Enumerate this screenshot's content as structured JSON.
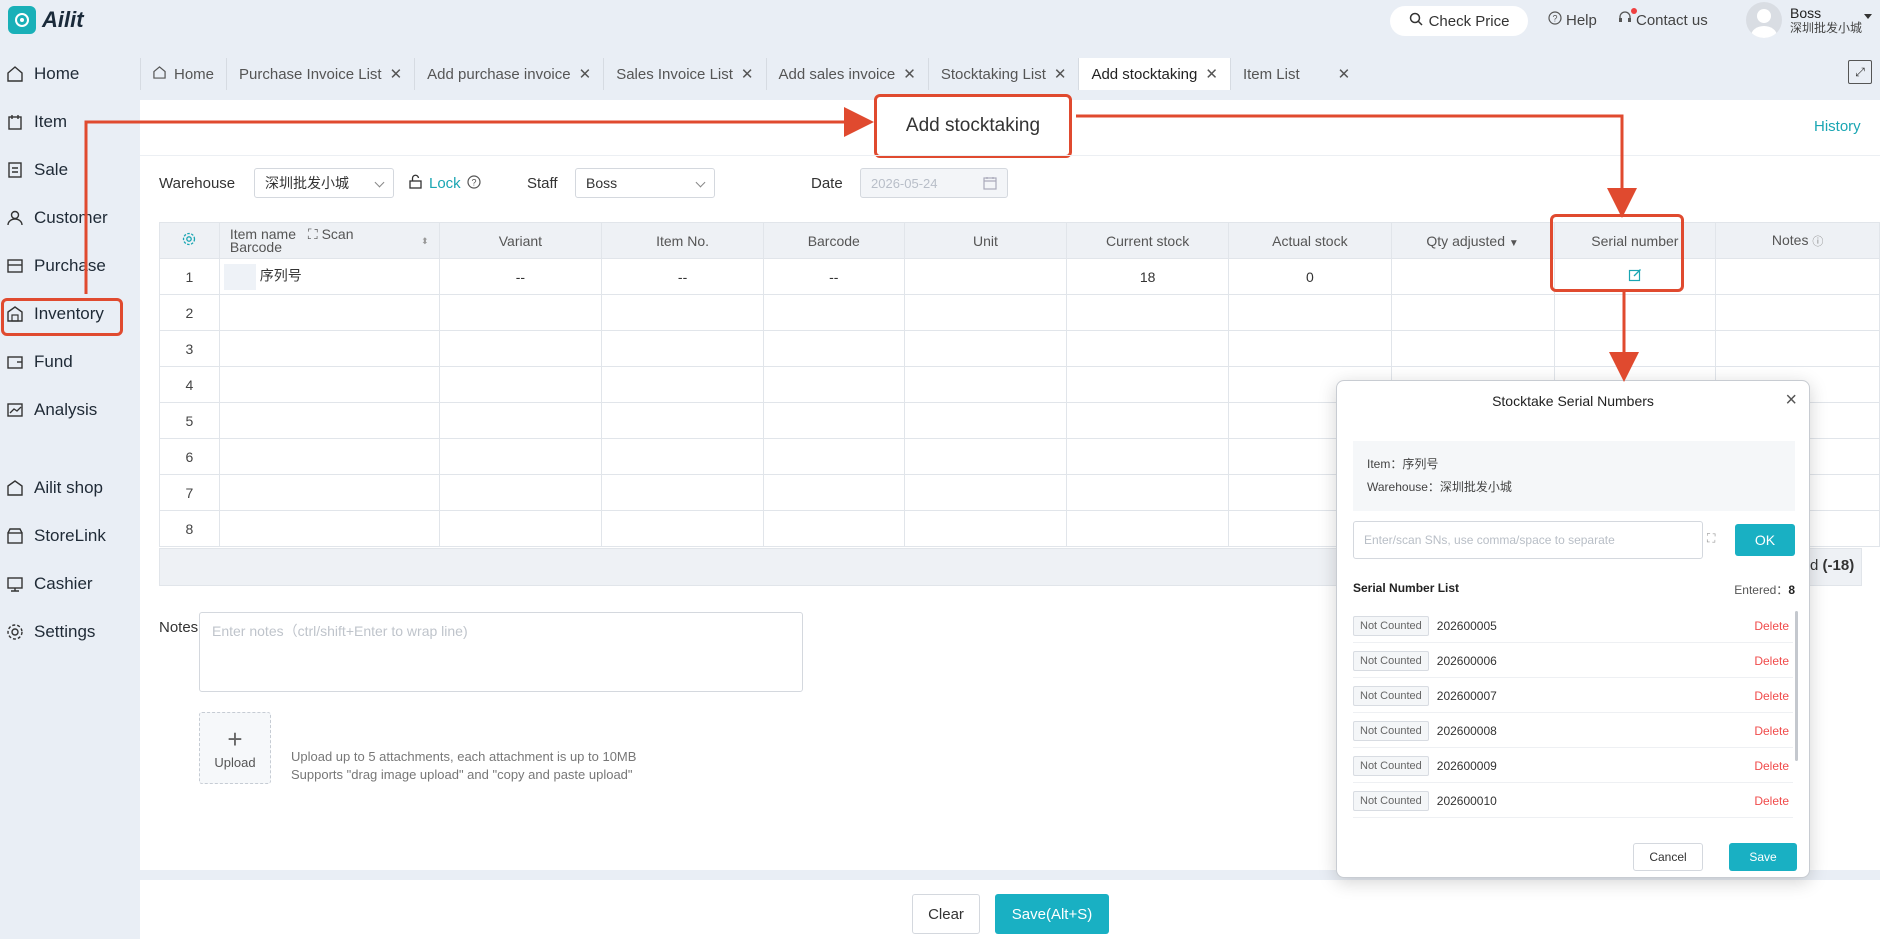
{
  "app": {
    "name": "Ailit",
    "check_price": "Check Price",
    "help": "Help",
    "contact": "Contact us",
    "user_name": "Boss",
    "user_shop": "深圳批发小城"
  },
  "sidebar": {
    "items": [
      {
        "label": "Home",
        "icon": "home-icon"
      },
      {
        "label": "Item",
        "icon": "item-icon"
      },
      {
        "label": "Sale",
        "icon": "sale-icon"
      },
      {
        "label": "Customer",
        "icon": "customer-icon"
      },
      {
        "label": "Purchase",
        "icon": "purchase-icon"
      },
      {
        "label": "Inventory",
        "icon": "inventory-icon"
      },
      {
        "label": "Fund",
        "icon": "fund-icon"
      },
      {
        "label": "Analysis",
        "icon": "analysis-icon"
      },
      {
        "label": "Ailit shop",
        "icon": "shop-icon"
      },
      {
        "label": "StoreLink",
        "icon": "storelink-icon"
      },
      {
        "label": "Cashier",
        "icon": "cashier-icon"
      },
      {
        "label": "Settings",
        "icon": "settings-icon"
      }
    ]
  },
  "tabs": [
    {
      "label": "Home",
      "closable": false
    },
    {
      "label": "Purchase Invoice List",
      "closable": true
    },
    {
      "label": "Add purchase invoice",
      "closable": true
    },
    {
      "label": "Sales Invoice List",
      "closable": true
    },
    {
      "label": "Add sales invoice",
      "closable": true
    },
    {
      "label": "Stocktaking List",
      "closable": true
    },
    {
      "label": "Add stocktaking",
      "closable": true,
      "active": true
    },
    {
      "label": "Item List",
      "closable": true
    }
  ],
  "page": {
    "title": "Add stocktaking",
    "history": "History"
  },
  "form": {
    "warehouse_label": "Warehouse",
    "warehouse_value": "深圳批发小城",
    "lock_label": "Lock",
    "staff_label": "Staff",
    "staff_value": "Boss",
    "date_label": "Date",
    "date_value": "2026-05-24"
  },
  "table": {
    "headers": {
      "item_name": "Item name",
      "scan": "Scan",
      "barcode_sub": "Barcode",
      "variant": "Variant",
      "item_no": "Item No.",
      "barcode": "Barcode",
      "unit": "Unit",
      "current_stock": "Current stock",
      "actual_stock": "Actual stock",
      "qty_adjusted": "Qty adjusted",
      "serial_number": "Serial number",
      "notes": "Notes"
    },
    "rows": [
      {
        "idx": "1",
        "item_name": "序列号",
        "variant": "--",
        "item_no": "--",
        "barcode": "--",
        "unit": "",
        "current_stock": "18",
        "actual_stock": "0"
      },
      {
        "idx": "2"
      },
      {
        "idx": "3"
      },
      {
        "idx": "4"
      },
      {
        "idx": "5"
      },
      {
        "idx": "6"
      },
      {
        "idx": "7"
      },
      {
        "idx": "8"
      }
    ],
    "footer_partial": "d",
    "footer_value": "(-18)"
  },
  "notes": {
    "label": "Notes",
    "placeholder": "Enter notes（ctrl/shift+Enter to wrap line)"
  },
  "upload": {
    "label": "Upload",
    "hint_line1": "Upload up to 5 attachments, each attachment is up to 10MB",
    "hint_line2": "Supports \"drag image upload\" and \"copy and paste upload\""
  },
  "actions": {
    "clear": "Clear",
    "save": "Save(Alt+S)"
  },
  "dialog": {
    "title": "Stocktake Serial Numbers",
    "item_line": "Item：序列号",
    "warehouse_line": "Warehouse：深圳批发小城",
    "input_placeholder": "Enter/scan SNs, use comma/space to separate",
    "ok": "OK",
    "list_title": "Serial Number List",
    "entered_label": "Entered：",
    "entered_count": "8",
    "serials": [
      {
        "status": "Not Counted",
        "sn": "202600005",
        "action": "Delete"
      },
      {
        "status": "Not Counted",
        "sn": "202600006",
        "action": "Delete"
      },
      {
        "status": "Not Counted",
        "sn": "202600007",
        "action": "Delete"
      },
      {
        "status": "Not Counted",
        "sn": "202600008",
        "action": "Delete"
      },
      {
        "status": "Not Counted",
        "sn": "202600009",
        "action": "Delete"
      },
      {
        "status": "Not Counted",
        "sn": "202600010",
        "action": "Delete"
      }
    ],
    "cancel": "Cancel",
    "save": "Save"
  },
  "colors": {
    "accent": "#19b0c3",
    "highlight": "#e04a2f",
    "delete": "#f04b4b"
  }
}
